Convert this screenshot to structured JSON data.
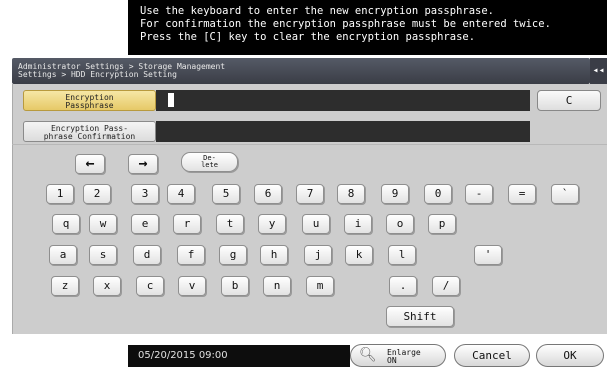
{
  "instructions": {
    "line1": "Use the keyboard to enter the new encryption passphrase.",
    "line2": "For confirmation the encryption passphrase must be entered twice.",
    "line3": "Press the [C] key to clear the encryption passphrase."
  },
  "breadcrumb": {
    "line1": "Administrator Settings > Storage Management",
    "line2": "Settings > HDD Encryption Setting",
    "side_tab": "◂◂"
  },
  "fields": {
    "passphrase_label_1": "Encryption",
    "passphrase_label_2": "Passphrase",
    "passphrase_value": "",
    "confirm_label_1": "Encryption Pass-",
    "confirm_label_2": "phrase Confirmation",
    "confirm_value": "",
    "clear_label": "C"
  },
  "keyboard": {
    "left_arrow": "←",
    "right_arrow": "→",
    "delete_1": "De-",
    "delete_2": "lete",
    "row1": [
      "1",
      "2",
      "3",
      "4",
      "5",
      "6",
      "7",
      "8",
      "9",
      "0",
      "-",
      "=",
      "`"
    ],
    "row2": [
      "q",
      "w",
      "e",
      "r",
      "t",
      "y",
      "u",
      "i",
      "o",
      "p"
    ],
    "row3": [
      "a",
      "s",
      "d",
      "f",
      "g",
      "h",
      "j",
      "k",
      "l",
      "'"
    ],
    "row4": [
      "z",
      "x",
      "c",
      "v",
      "b",
      "n",
      "m",
      ".",
      "/"
    ],
    "shift": "Shift"
  },
  "footer": {
    "datetime": "05/20/2015  09:00",
    "enlarge_1": "Enlarge",
    "enlarge_2": "ON",
    "enlarge_icon": "enlarge-magnifier-icon",
    "cancel": "Cancel",
    "ok": "OK"
  }
}
